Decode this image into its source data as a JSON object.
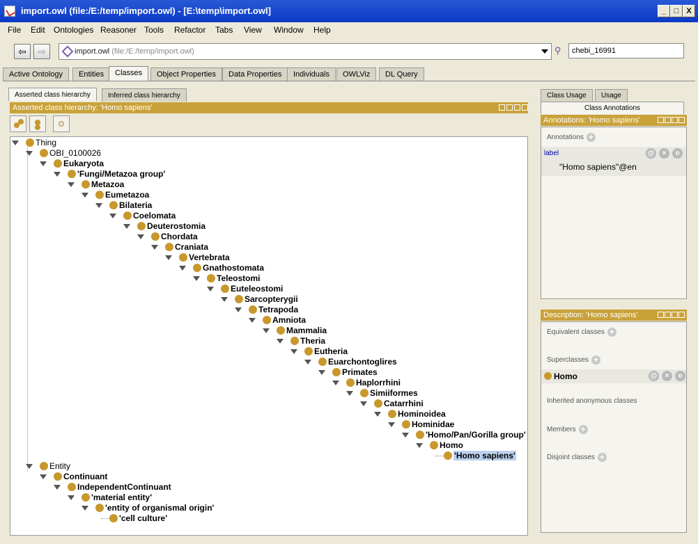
{
  "window": {
    "title": "import.owl (file:/E:/temp/import.owl) - [E:\\temp\\import.owl]",
    "minimize": "_",
    "maximize": "□",
    "close": "X"
  },
  "menu": [
    "File",
    "Edit",
    "Ontologies",
    "Reasoner",
    "Tools",
    "Refactor",
    "Tabs",
    "View",
    "Window",
    "Help"
  ],
  "toolbar": {
    "back": "⇦",
    "forward": "⇨",
    "ontology_name": "import.owl",
    "ontology_path": "(file:/E:/temp/import.owl)",
    "search_value": "chebi_16991"
  },
  "tabs": [
    "Active Ontology",
    "Entities",
    "Classes",
    "Object Properties",
    "Data Properties",
    "Individuals",
    "OWLViz",
    "DL Query"
  ],
  "active_tab": "Classes",
  "hierarchy": {
    "subtabs": [
      "Asserted class hierarchy",
      "Inferred class hierarchy"
    ],
    "header": "Asserted class hierarchy: 'Homo sapiens'",
    "tree": [
      {
        "label": "Thing",
        "bold": false
      },
      {
        "label": "OBI_0100026",
        "bold": false
      },
      {
        "label": "Eukaryota",
        "bold": true
      },
      {
        "label": "'Fungi/Metazoa group'",
        "bold": true
      },
      {
        "label": "Metazoa",
        "bold": true
      },
      {
        "label": "Eumetazoa",
        "bold": true
      },
      {
        "label": "Bilateria",
        "bold": true
      },
      {
        "label": "Coelomata",
        "bold": true
      },
      {
        "label": "Deuterostomia",
        "bold": true
      },
      {
        "label": "Chordata",
        "bold": true
      },
      {
        "label": "Craniata",
        "bold": true
      },
      {
        "label": "Vertebrata",
        "bold": true
      },
      {
        "label": "Gnathostomata",
        "bold": true
      },
      {
        "label": "Teleostomi",
        "bold": true
      },
      {
        "label": "Euteleostomi",
        "bold": true
      },
      {
        "label": "Sarcopterygii",
        "bold": true
      },
      {
        "label": "Tetrapoda",
        "bold": true
      },
      {
        "label": "Amniota",
        "bold": true
      },
      {
        "label": "Mammalia",
        "bold": true
      },
      {
        "label": "Theria",
        "bold": true
      },
      {
        "label": "Eutheria",
        "bold": true
      },
      {
        "label": "Euarchontoglires",
        "bold": true
      },
      {
        "label": "Primates",
        "bold": true
      },
      {
        "label": "Haplorrhini",
        "bold": true
      },
      {
        "label": "Simiiformes",
        "bold": true
      },
      {
        "label": "Catarrhini",
        "bold": true
      },
      {
        "label": "Hominoidea",
        "bold": true
      },
      {
        "label": "Hominidae",
        "bold": true
      },
      {
        "label": "'Homo/Pan/Gorilla group'",
        "bold": true
      },
      {
        "label": "Homo",
        "bold": true
      },
      {
        "label": "'Homo sapiens'",
        "bold": true,
        "selected": true
      },
      {
        "label": "Entity",
        "bold": false
      },
      {
        "label": "Continuant",
        "bold": true
      },
      {
        "label": "IndependentContinuant",
        "bold": true
      },
      {
        "label": "'material entity'",
        "bold": true
      },
      {
        "label": "'entity of organismal origin'",
        "bold": true
      },
      {
        "label": "'cell culture'",
        "bold": true
      }
    ]
  },
  "right": {
    "subtabs": [
      "Class Usage",
      "Usage"
    ],
    "active_subtab": "Class Annotations",
    "annotations_header": "Annotations: 'Homo sapiens'",
    "annotations_label": "Annotations",
    "annotation_property": "label",
    "annotation_value": "\"Homo sapiens\"@en",
    "description_header": "Description: 'Homo sapiens'",
    "sections": {
      "equivalent": "Equivalent classes",
      "superclasses": "Superclasses",
      "superclass_value": "Homo",
      "inherited": "Inherited anonymous classes",
      "members": "Members",
      "disjoint": "Disjoint classes"
    }
  }
}
